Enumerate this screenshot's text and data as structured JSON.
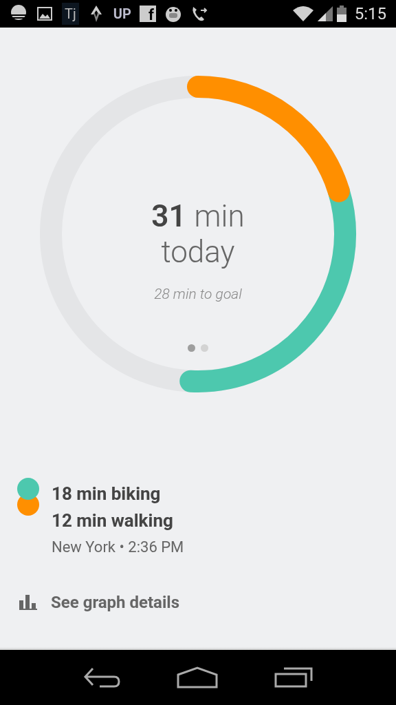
{
  "status_bar": {
    "notifications": [
      {
        "kind": "sun"
      },
      {
        "kind": "image"
      },
      {
        "kind": "text",
        "text": "Tj"
      },
      {
        "kind": "arrows"
      },
      {
        "kind": "text",
        "text": "UP"
      },
      {
        "kind": "text",
        "text": "f",
        "boxed": true
      },
      {
        "kind": "mascot"
      },
      {
        "kind": "phone"
      }
    ],
    "time": "5:15"
  },
  "ring": {
    "segments": [
      {
        "color": "#ff8f00"
      },
      {
        "color": "#4dc8ae"
      }
    ]
  },
  "summary": {
    "value": "31",
    "unit": "min",
    "period": "today",
    "goal_text": "28 min to goal"
  },
  "pages": [
    {
      "selected": true
    },
    {
      "selected": false
    }
  ],
  "activities": [
    {
      "text": "18 min biking",
      "color": "#4dc8ae"
    },
    {
      "text": "12 min walking",
      "color": "#ff8f00"
    }
  ],
  "place_time": "New York • 2:36 PM",
  "graph_link": "See graph details"
}
